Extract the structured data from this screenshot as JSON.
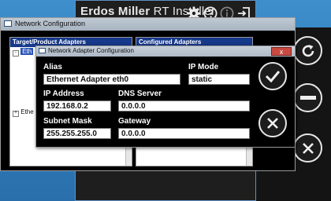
{
  "installer": {
    "title_bold": "Erdos Miller",
    "title_rest": " RT Installer",
    "icons": [
      "gear-icon",
      "help-icon",
      "info-icon",
      "exit-icon"
    ]
  },
  "side_buttons": [
    "refresh-button",
    "remove-button",
    "confirm-button",
    "cancel-button"
  ],
  "network_window": {
    "title": "Network Configuration",
    "target_header": "Target/Product Adapters",
    "configured_header": "Configured Adapters",
    "tree_items": [
      "Eth",
      "Ethe"
    ]
  },
  "dialog": {
    "title": "Network Adapter Configuration",
    "close_label": "x",
    "alias": {
      "label": "Alias",
      "value": "Ethernet Adapter eth0"
    },
    "ip_mode": {
      "label": "IP Mode",
      "value": "static"
    },
    "ip_address": {
      "label": "IP Address",
      "value": "192.168.0.2"
    },
    "dns_server": {
      "label": "DNS Server",
      "value": "0.0.0.0"
    },
    "subnet_mask": {
      "label": "Subnet Mask",
      "value": "255.255.255.0"
    },
    "gateway": {
      "label": "Gateway",
      "value": "0.0.0.0"
    }
  }
}
